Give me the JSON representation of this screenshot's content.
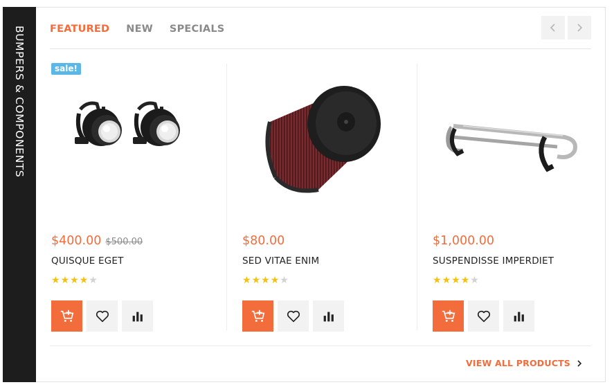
{
  "sidebar": {
    "title": "BUMPERS & COMPONENTS"
  },
  "tabs": [
    {
      "label": "FEATURED",
      "active": true
    },
    {
      "label": "NEW",
      "active": false
    },
    {
      "label": "SPECIALS",
      "active": false
    }
  ],
  "nav": {
    "prev_icon": "chevron-left-icon",
    "next_icon": "chevron-right-icon"
  },
  "products": [
    {
      "badge": "sale!",
      "price": "$400.00",
      "old_price": "$500.00",
      "name": "QUISQUE EGET",
      "rating": 4,
      "rating_max": 5,
      "image": "fog-lights"
    },
    {
      "price": "$80.00",
      "name": "SED VITAE ENIM",
      "rating": 4,
      "rating_max": 5,
      "image": "air-filter"
    },
    {
      "price": "$1,000.00",
      "name": "SUSPENDISSE IMPERDIET",
      "rating": 4,
      "rating_max": 5,
      "image": "bumper-bar"
    }
  ],
  "view_all": {
    "label": "VIEW ALL PRODUCTS"
  },
  "colors": {
    "accent": "#f36c3c",
    "sidebar": "#1d1d1d",
    "badge": "#5bb7e6",
    "star": "#f4c20d"
  }
}
